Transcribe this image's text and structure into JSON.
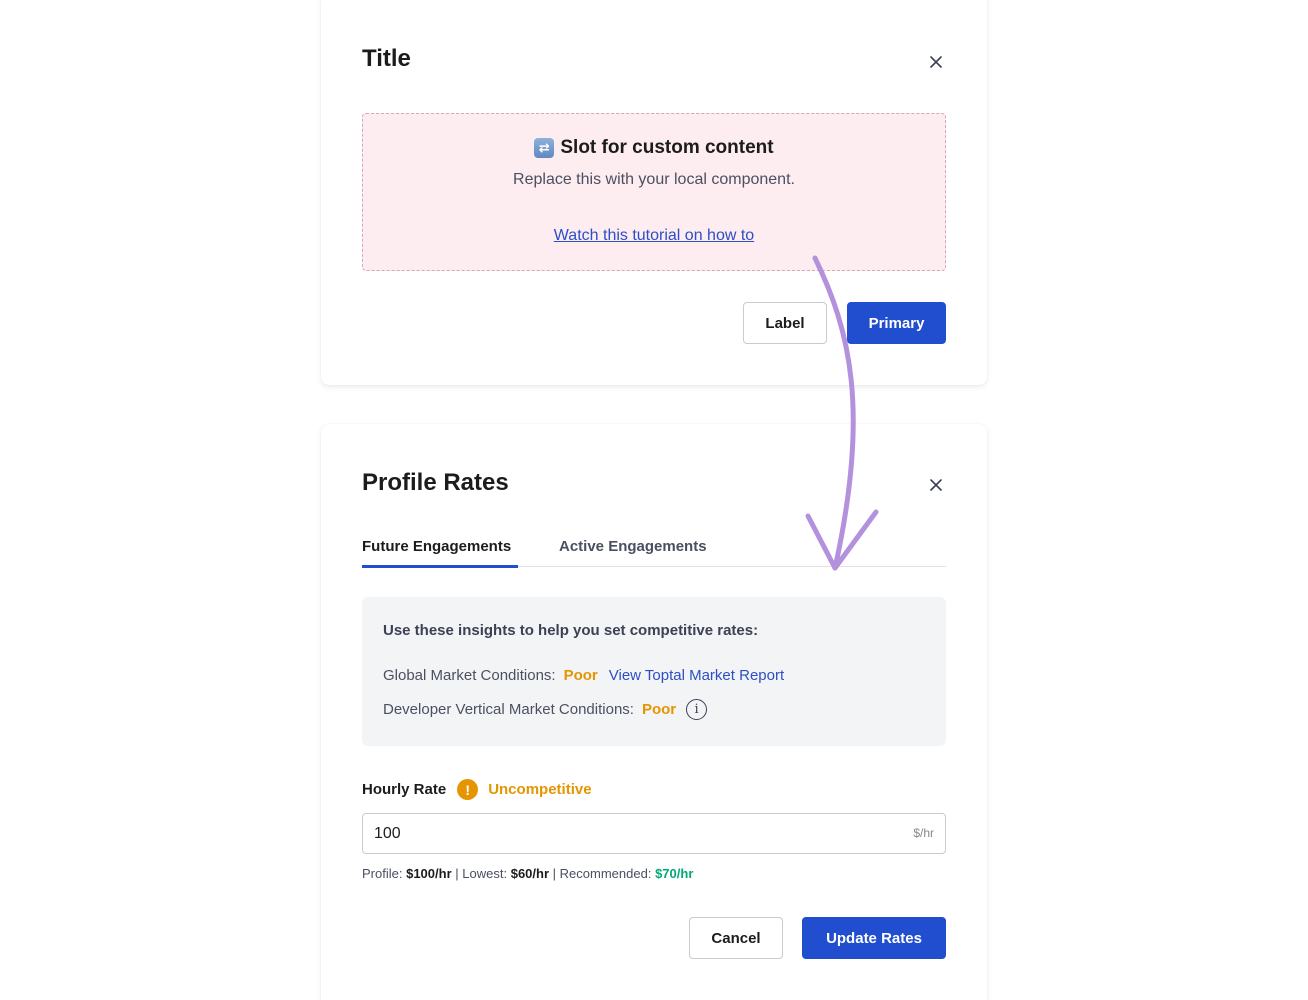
{
  "modal_top": {
    "title": "Title",
    "slot_heading": "Slot for custom content",
    "slot_subtext": "Replace this with your local component.",
    "slot_link": "Watch this tutorial on how to",
    "label_button": "Label",
    "primary_button": "Primary"
  },
  "modal_profile": {
    "title": "Profile Rates",
    "tabs": [
      {
        "label": "Future Engagements",
        "active": true
      },
      {
        "label": "Active Engagements",
        "active": false
      }
    ],
    "insights": {
      "heading": "Use these insights to help you set competitive rates:",
      "global_label": "Global Market Conditions:",
      "global_value": "Poor",
      "global_link": "View Toptal Market Report",
      "dev_label": "Developer Vertical Market Conditions:",
      "dev_value": "Poor"
    },
    "hourly_rate": {
      "label": "Hourly Rate",
      "status": "Uncompetitive",
      "value": "100",
      "unit": "$/hr"
    },
    "summary": {
      "profile_label": "Profile:",
      "profile_value": "$100/hr",
      "lowest_label": "Lowest:",
      "lowest_value": "$60/hr",
      "recommended_label": "Recommended:",
      "recommended_value": "$70/hr"
    },
    "cancel_button": "Cancel",
    "update_button": "Update Rates"
  },
  "colors": {
    "primary": "#204ecf",
    "warning": "#e59500",
    "success": "#03a877",
    "slot_bg": "#fdecf0",
    "arrow": "#b491dd"
  }
}
